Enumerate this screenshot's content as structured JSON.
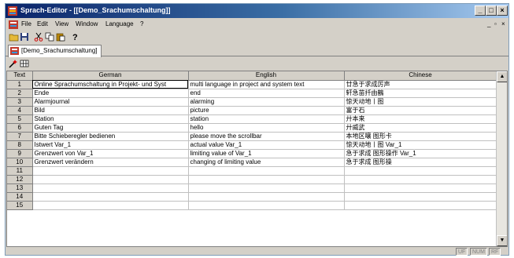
{
  "window": {
    "title": "Sprach-Editor - [[Demo_Srachumschaltung]]",
    "controls": {
      "minimize": "_",
      "maximize": "□",
      "close": "×"
    }
  },
  "menubar": {
    "items": [
      {
        "label": "File"
      },
      {
        "label": "Edit"
      },
      {
        "label": "View"
      },
      {
        "label": "Window"
      },
      {
        "label": "Language"
      },
      {
        "label": "?"
      }
    ],
    "mdi_controls": {
      "minimize": "_",
      "restore": "▫",
      "close": "×"
    }
  },
  "toolbar": {
    "icons": [
      "open-icon",
      "save-icon",
      "cut-icon",
      "copy-icon",
      "paste-icon",
      "help-icon"
    ]
  },
  "tab": {
    "label": "[Demo_Srachumschaltung]"
  },
  "grid": {
    "columns": [
      "Text",
      "German",
      "English",
      "Chinese"
    ],
    "rows": [
      {
        "n": "1",
        "de": "Online Sprachumschaltung in Projekt- und Syst",
        "en": "multi language in project and system text",
        "zh": "廿急于求成厉声"
      },
      {
        "n": "2",
        "de": "Ende",
        "en": "end",
        "zh": "轩急苗扦由鶴"
      },
      {
        "n": "3",
        "de": "Alarmjournal",
        "en": "alarming",
        "zh": "惊天动地丨图"
      },
      {
        "n": "4",
        "de": "Bild",
        "en": "picture",
        "zh": "富于石"
      },
      {
        "n": "5",
        "de": "Station",
        "en": "station",
        "zh": "廾本来"
      },
      {
        "n": "6",
        "de": "Guten Tag",
        "en": "hello",
        "zh": "廾威武"
      },
      {
        "n": "7",
        "de": "Bitte Schieberegler bedienen",
        "en": "please move the scrollbar",
        "zh": "本地区嚷 图形卡"
      },
      {
        "n": "8",
        "de": "Istwert Var_1",
        "en": "actual value Var_1",
        "zh": "惊天动地丨图 Var_1"
      },
      {
        "n": "9",
        "de": "Grenzwert von Var_1",
        "en": "limiting value of Var_1",
        "zh": "急于求成 图形操作 Var_1"
      },
      {
        "n": "10",
        "de": "Grenzwert verändern",
        "en": "changing of limiting value",
        "zh": "急于求成 图形操"
      },
      {
        "n": "11",
        "de": "",
        "en": "",
        "zh": ""
      },
      {
        "n": "12",
        "de": "",
        "en": "",
        "zh": ""
      },
      {
        "n": "13",
        "de": "",
        "en": "",
        "zh": ""
      },
      {
        "n": "14",
        "de": "",
        "en": "",
        "zh": ""
      },
      {
        "n": "15",
        "de": "",
        "en": "",
        "zh": ""
      }
    ]
  },
  "scrollbar": {
    "up": "▲",
    "down": "▼"
  },
  "statusbar": {
    "panels": [
      "UF",
      "NUM",
      "RF"
    ]
  },
  "colors": {
    "title_start": "#0a246a",
    "title_end": "#a6caf0",
    "chrome": "#d4d0c8"
  }
}
